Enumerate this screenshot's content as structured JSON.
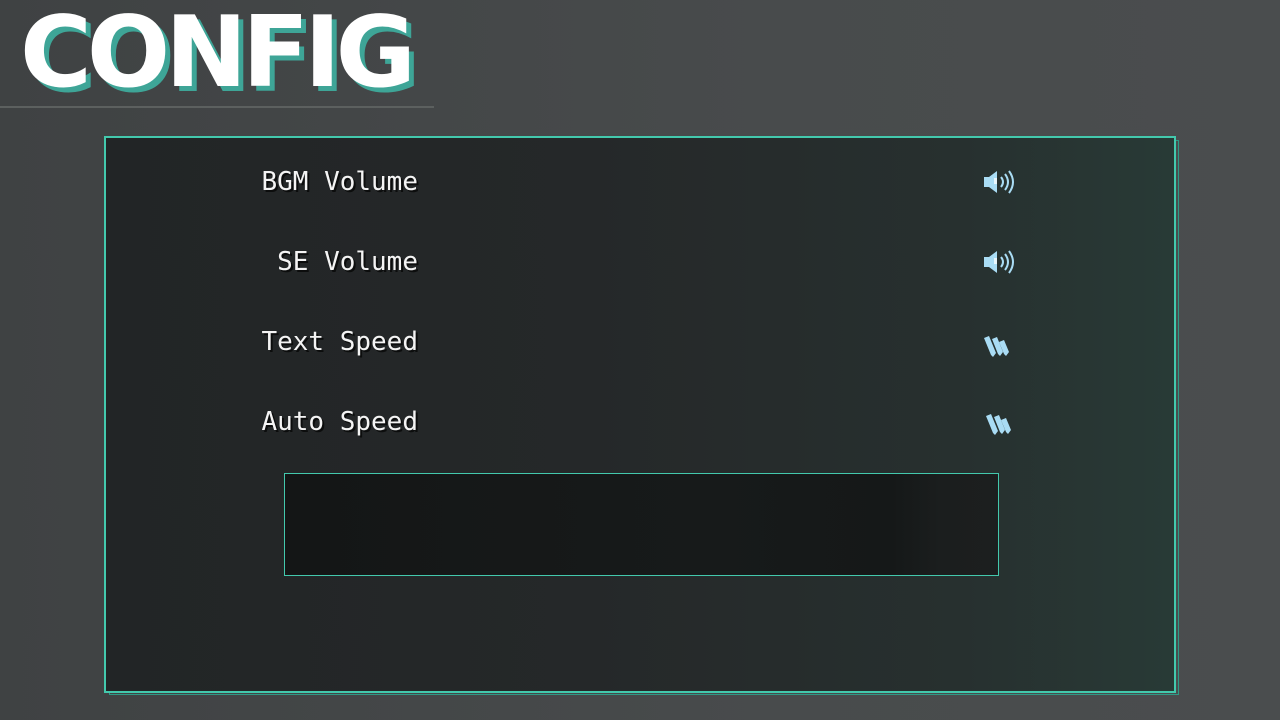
{
  "header": {
    "title": "CONFIG"
  },
  "colors": {
    "accent": "#43c9ad",
    "title_shadow": "#3ea597",
    "icon": "#a9dcf4",
    "text": "#f4f4f4"
  },
  "settings": [
    {
      "label": "BGM Volume",
      "icon": "speaker-volume-icon"
    },
    {
      "label": "SE Volume",
      "icon": "speaker-volume-icon"
    },
    {
      "label": "Text Speed",
      "icon": "pencils-icon"
    },
    {
      "label": "Auto Speed",
      "icon": "pencils-icon"
    }
  ],
  "message_box": {
    "text": ""
  }
}
